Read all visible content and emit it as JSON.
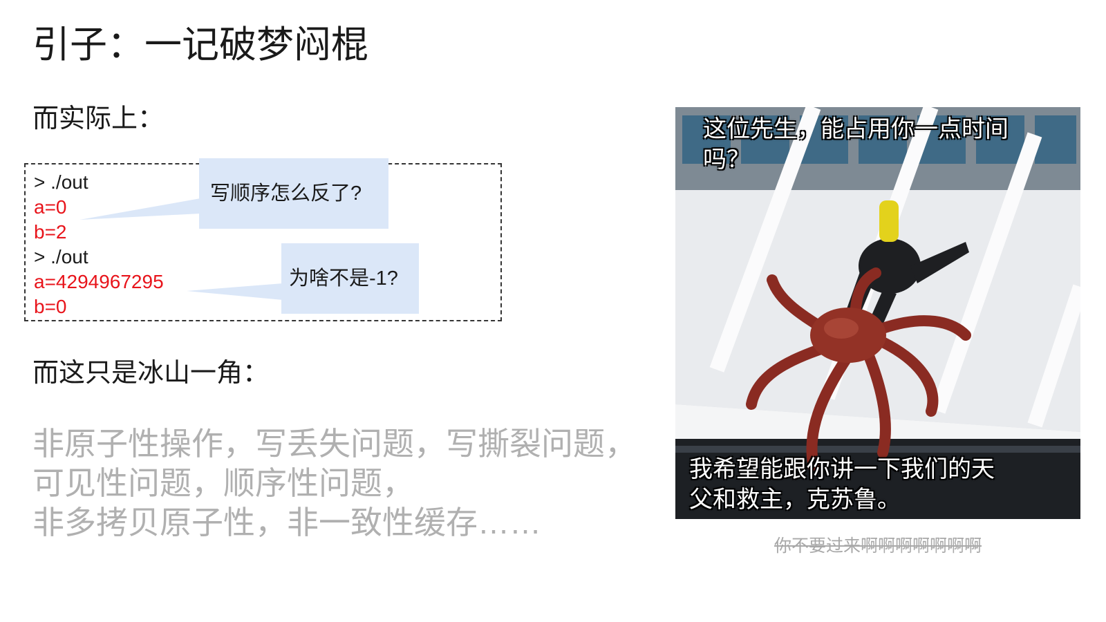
{
  "title": "引子：一记破梦闷棍",
  "subhead_1": "而实际上：",
  "terminal": {
    "lines": [
      {
        "text": "> ./out",
        "kind": "cmd"
      },
      {
        "text": "a=0",
        "kind": "out"
      },
      {
        "text": "b=2",
        "kind": "out"
      },
      {
        "text": "> ./out",
        "kind": "cmd"
      },
      {
        "text": "a=4294967295",
        "kind": "out"
      },
      {
        "text": "b=0",
        "kind": "out"
      }
    ]
  },
  "callouts": {
    "order_question": "写顺序怎么反了?",
    "value_question": "为啥不是-1?"
  },
  "subhead_2": "而这只是冰山一角：",
  "bullets": [
    "非原子性操作，写丢失问题，写撕裂问题，",
    "可见性问题，顺序性问题，",
    "非多拷贝原子性，非一致性缓存……"
  ],
  "meme": {
    "top_text_lines": [
      "这位先生，能占用你一点时间",
      "吗？"
    ],
    "bottom_text_lines": [
      "我希望能跟你讲一下我们的天",
      "父和救主，克苏鲁。"
    ]
  },
  "caption": "你不要过来啊啊啊啊啊啊啊",
  "colors": {
    "output_red": "#e8141b",
    "callout_bg": "#dbe7f8",
    "muted_text": "#b0b0b0"
  }
}
